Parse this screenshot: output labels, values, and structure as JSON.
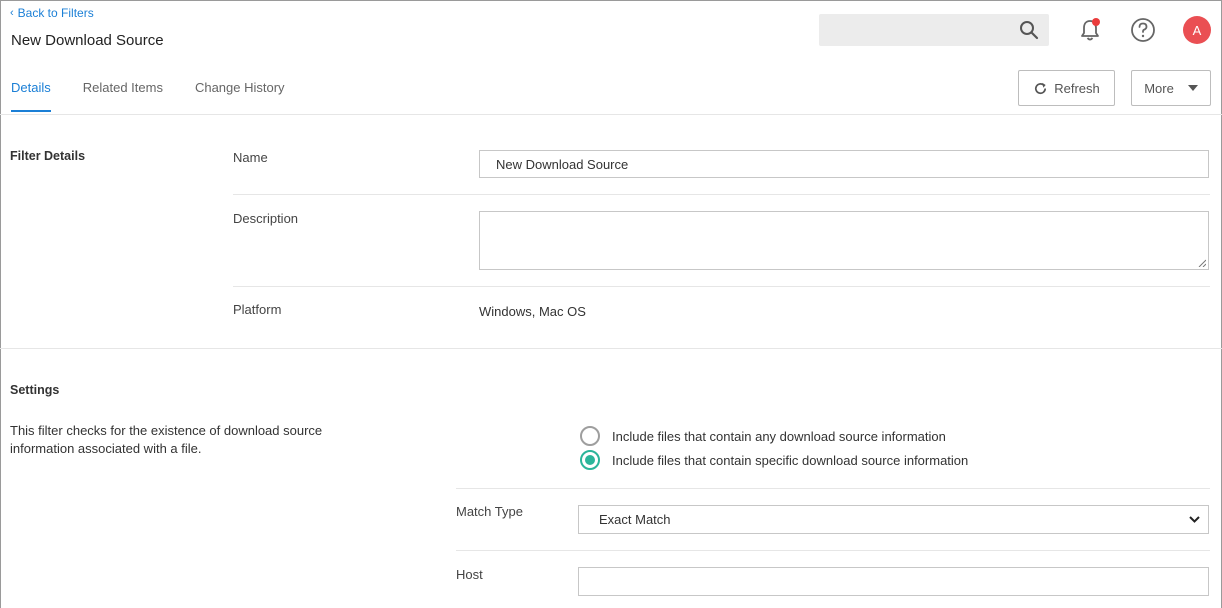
{
  "header": {
    "back_link": "Back to Filters",
    "title": "New Download Source",
    "search": {
      "placeholder": ""
    },
    "avatar_initial": "A"
  },
  "tabs": [
    {
      "label": "Details",
      "active": true
    },
    {
      "label": "Related Items",
      "active": false
    },
    {
      "label": "Change History",
      "active": false
    }
  ],
  "toolbar": {
    "refresh_label": "Refresh",
    "more_label": "More"
  },
  "filter_details": {
    "section_title": "Filter Details",
    "name_label": "Name",
    "name_value": "New Download Source",
    "description_label": "Description",
    "description_value": "",
    "platform_label": "Platform",
    "platform_value": "Windows, Mac OS"
  },
  "settings": {
    "section_title": "Settings",
    "description": "This filter checks for the existence of download source information associated with a file.",
    "options": [
      {
        "label": "Include files that contain any download source information",
        "selected": false
      },
      {
        "label": "Include files that contain specific download source information",
        "selected": true
      }
    ],
    "match_type_label": "Match Type",
    "match_type_value": "Exact Match",
    "host_label": "Host",
    "host_value": ""
  },
  "colors": {
    "accent": "#1b7fd6",
    "radio_selected": "#2bb59a",
    "avatar": "#ea4f53",
    "notification_dot": "#ea3c3c"
  },
  "icons": {
    "back": "chevron-left-icon",
    "search": "search-icon",
    "notifications": "bell-icon",
    "help": "help-circle-icon",
    "refresh": "refresh-icon",
    "more": "caret-down-icon",
    "select": "chevron-down-icon"
  }
}
